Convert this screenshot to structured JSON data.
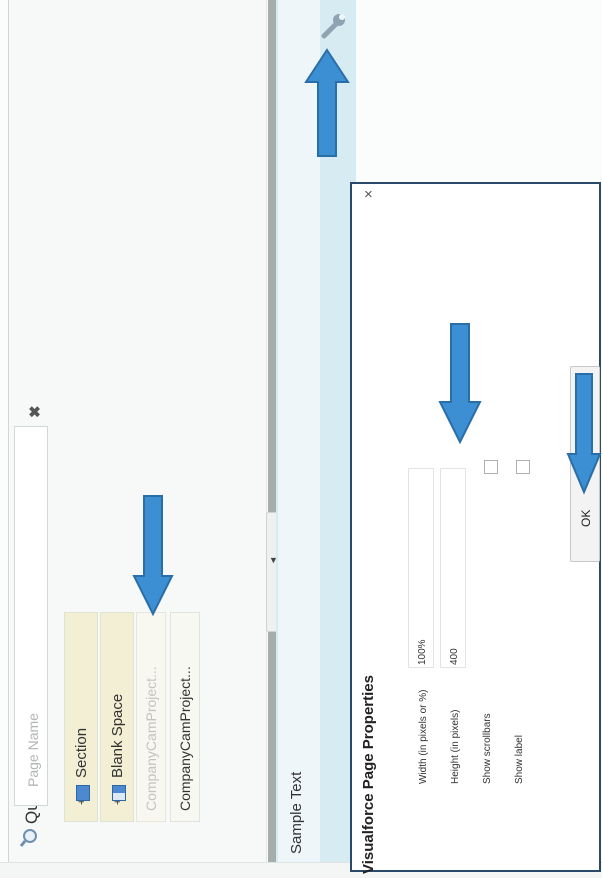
{
  "palette": {
    "quick_find_label": "Quick Find",
    "search_placeholder": "Page Name",
    "clear_glyph": "✖",
    "items": [
      "Section",
      "Blank Space",
      "CompanyCamProject...",
      "CompanyCamProject..."
    ],
    "expand_glyph": "+"
  },
  "collapse_glyph": "◄",
  "canvas": {
    "sample_text": "Sample Text"
  },
  "dialog": {
    "title": "Visualforce Page Properties",
    "close_glyph": "×",
    "width_label": "Width (in pixels or %)",
    "width_value": "100%",
    "height_label": "Height (in pixels)",
    "height_value": "400",
    "show_scrollbars_label": "Show scrollbars",
    "show_scrollbars_checked": false,
    "show_label_label": "Show label",
    "show_label_checked": false,
    "ok_label": "OK"
  },
  "colors": {
    "accent_arrow": "#3c8fd2",
    "dialog_border": "#2b4a6a",
    "chip_bg": "#f3efd4"
  },
  "icons": [
    "search-icon",
    "wrench-icon",
    "clear-icon",
    "close-icon",
    "collapse-arrow-icon"
  ]
}
